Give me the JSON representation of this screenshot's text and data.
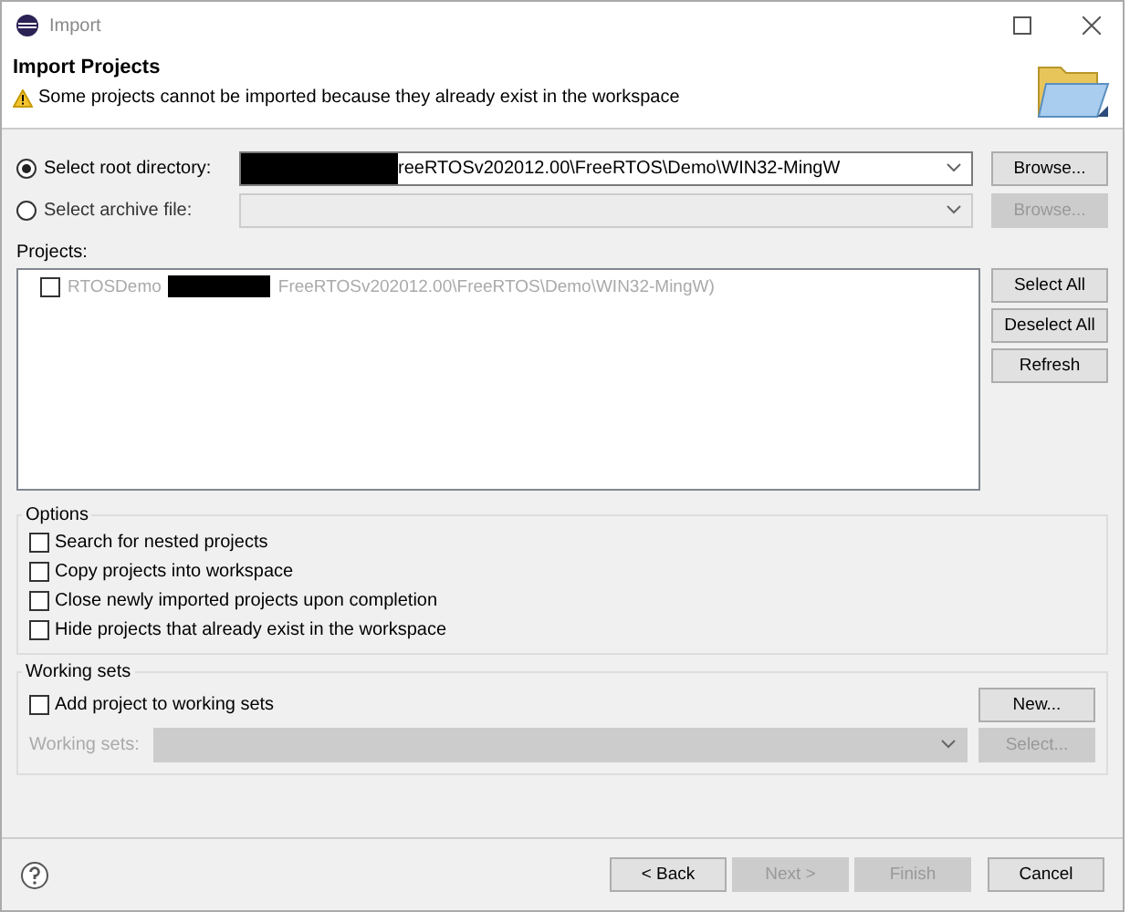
{
  "window": {
    "title": "Import"
  },
  "header": {
    "title": "Import Projects",
    "message": "Some projects cannot be imported because they already exist in the workspace"
  },
  "sources": [
    {
      "label": "Select root directory:",
      "selected": true,
      "disabled": false,
      "value": "reeRTOSv202012.00\\FreeRTOS\\Demo\\WIN32-MingW",
      "redacted": true,
      "button": "Browse..."
    },
    {
      "label": "Select archive file:",
      "selected": false,
      "disabled": true,
      "redacted": false,
      "button": "Browse..."
    }
  ],
  "projects": {
    "label": "Projects:",
    "items": [
      {
        "name": "RTOSDemo",
        "path": "FreeRTOSv202012.00\\FreeRTOS\\Demo\\WIN32-MingW)",
        "checked": false,
        "disabled": true
      }
    ],
    "buttons": [
      "Select All",
      "Deselect All",
      "Refresh"
    ]
  },
  "options": {
    "title": "Options",
    "items": [
      {
        "label": "Search for nested projects",
        "checked": false
      },
      {
        "label": "Copy projects into workspace",
        "checked": false
      },
      {
        "label": "Close newly imported projects upon completion",
        "checked": false
      },
      {
        "label": "Hide projects that already exist in the workspace",
        "checked": false
      }
    ]
  },
  "working_sets": {
    "title": "Working sets",
    "checkbox": {
      "label": "Add project to working sets",
      "checked": false
    },
    "new_button": "New...",
    "field_label": "Working sets:",
    "select_button": "Select...",
    "disabled": true
  },
  "footer": {
    "buttons": [
      {
        "label": "< Back",
        "disabled": false
      },
      {
        "label": "Next >",
        "disabled": true
      },
      {
        "label": "Finish",
        "disabled": true
      },
      {
        "label": "Cancel",
        "disabled": false
      }
    ]
  }
}
